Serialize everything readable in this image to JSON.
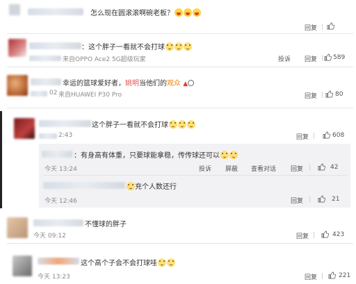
{
  "comments": [
    {
      "text": "怎么现在圆滚滚啊碗老板？",
      "emojis": [
        "laugh",
        "laugh",
        "laugh"
      ],
      "reply_label": "回复"
    },
    {
      "text": "：这个胖子一看就不会打球",
      "emojis": [
        "yell",
        "yell",
        "yell"
      ],
      "meta": "来自OPPO Ace2 5G超级玩家",
      "report_label": "投诉",
      "reply_label": "回复",
      "likes": "589"
    },
    {
      "text": "幸运的篮球爱好者，",
      "text_red": "姚明",
      "text_mid": "当他们的",
      "text_orange": "观众",
      "meta_time": "02",
      "meta_device": "来自HUAWEI P30 Pro",
      "reply_label": "回复",
      "likes": "80"
    },
    {
      "text": "这个胖子一看就不会打球",
      "emojis": [
        "yell",
        "yell",
        "yell"
      ],
      "time": "2:43",
      "reply_label": "回复",
      "likes": "608",
      "replies": [
        {
          "text": "：有身高有体重，只要球能拿稳，传传球还可以",
          "emojis": [
            "yell",
            "yell"
          ],
          "time": "今天 13:24",
          "actions": [
            "投诉",
            "屏蔽",
            "查看对话",
            "回复"
          ],
          "likes": "42"
        },
        {
          "text": "充个人数还行",
          "emojis": [
            "yell"
          ],
          "time": "今天 12:46",
          "reply_label": "回复",
          "likes": "21"
        }
      ]
    },
    {
      "text": "不懂球的胖子",
      "time": "今天 09:12",
      "reply_label": "回复",
      "likes": "423"
    },
    {
      "text": "这个高个子会不会打球哇",
      "emojis": [
        "yell",
        "yell"
      ],
      "time": "今天 13:23",
      "reply_label": "回复",
      "likes": "221"
    }
  ],
  "colors": {
    "highlight_red": "#e0534a",
    "highlight_orange": "#f08300"
  },
  "icons": {
    "like": "thumbs-up-icon"
  }
}
